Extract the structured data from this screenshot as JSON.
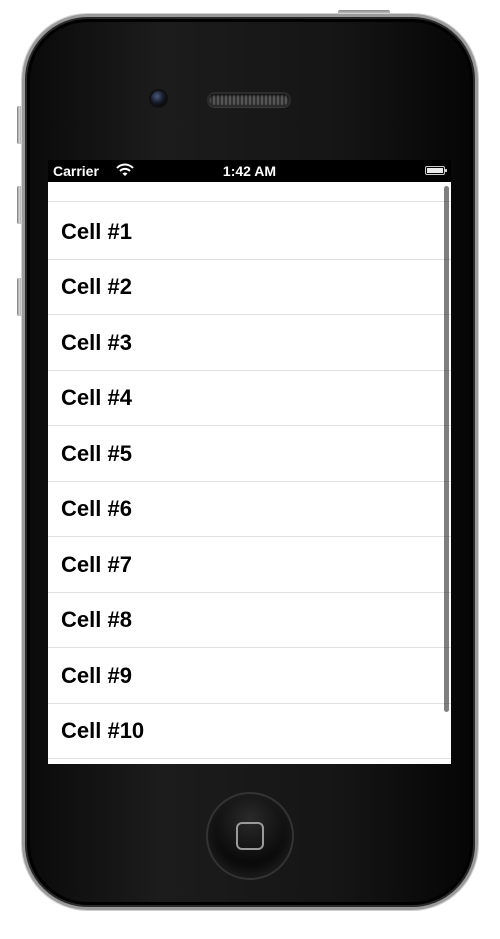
{
  "status_bar": {
    "carrier": "Carrier",
    "wifi_icon": "wifi-icon",
    "time": "1:42 AM",
    "battery_icon": "battery-icon"
  },
  "table": {
    "cells": [
      {
        "label": ""
      },
      {
        "label": "Cell #1"
      },
      {
        "label": "Cell #2"
      },
      {
        "label": "Cell #3"
      },
      {
        "label": "Cell #4"
      },
      {
        "label": "Cell #5"
      },
      {
        "label": "Cell #6"
      },
      {
        "label": "Cell #7"
      },
      {
        "label": "Cell #8"
      },
      {
        "label": "Cell #9"
      },
      {
        "label": "Cell #10"
      }
    ]
  },
  "device": {
    "home_button_icon": "home-square-icon",
    "camera_icon": "front-camera-icon",
    "speaker_icon": "earpiece-speaker-icon"
  },
  "colors": {
    "screen_bg": "#ffffff",
    "status_bar_bg": "#000000",
    "cell_text": "#000000",
    "separator": "#e0e0e0"
  }
}
